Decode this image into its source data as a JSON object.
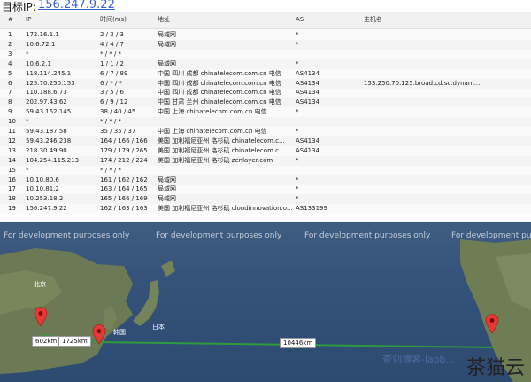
{
  "header": {
    "label": "目标IP:",
    "ip": "156.247.9.22"
  },
  "table": {
    "columns": [
      "#",
      "IP",
      "时间(ms)",
      "地址",
      "AS",
      "主机名"
    ],
    "rows": [
      [
        "1",
        "172.16.1.1",
        "2 / 3 / 3",
        "局域网",
        "*",
        ""
      ],
      [
        "2",
        "10.6.72.1",
        "4 / 4 / 7",
        "局域网",
        "*",
        ""
      ],
      [
        "3",
        "*",
        "* / * / *",
        "",
        "",
        ""
      ],
      [
        "4",
        "10.6.2.1",
        "1 / 1 / 2",
        "局域网",
        "*",
        ""
      ],
      [
        "5",
        "118.114.245.1",
        "6 / 7 / 89",
        "中国 四川 成都 chinatelecom.com.cn 电信",
        "AS4134",
        ""
      ],
      [
        "6",
        "125.70.250.153",
        "6 / * / *",
        "中国 四川 成都 chinatelecom.com.cn 电信",
        "AS4134",
        "153.250.70.125.broad.cd.sc.dynam..."
      ],
      [
        "7",
        "110.188.6.73",
        "3 / 5 / 6",
        "中国 四川 成都 chinatelecom.com.cn 电信",
        "AS4134",
        ""
      ],
      [
        "8",
        "202.97.43.62",
        "6 / 9 / 12",
        "中国 甘肃 兰州 chinatelecom.com.cn 电信",
        "AS4134",
        ""
      ],
      [
        "9",
        "59.43.152.145",
        "38 / 40 / 45",
        "中国 上海 chinatelecom.com.cn 电信",
        "*",
        ""
      ],
      [
        "10",
        "*",
        "* / * / *",
        "",
        "",
        ""
      ],
      [
        "11",
        "59.43.187.58",
        "35 / 35 / 37",
        "中国 上海 chinatelecom.com.cn 电信",
        "*",
        ""
      ],
      [
        "12",
        "59.43.246.238",
        "164 / 166 / 166",
        "美国 加利福尼亚州 洛杉矶 chinatelecom.c...",
        "AS4134",
        ""
      ],
      [
        "13",
        "218.30.49.90",
        "179 / 179 / 265",
        "美国 加利福尼亚州 洛杉矶 chinatelecom.c...",
        "AS4134",
        ""
      ],
      [
        "14",
        "104.254.115.213",
        "174 / 212 / 224",
        "美国 加利福尼亚州 洛杉矶 zenlayer.com",
        "*",
        ""
      ],
      [
        "15",
        "*",
        "* / * / *",
        "",
        "",
        ""
      ],
      [
        "16",
        "10.10.80.6",
        "161 / 162 / 162",
        "局域网",
        "*",
        ""
      ],
      [
        "17",
        "10.10.81.2",
        "163 / 164 / 165",
        "局域网",
        "*",
        ""
      ],
      [
        "18",
        "10.253.18.2",
        "165 / 166 / 169",
        "局域网",
        "*",
        ""
      ],
      [
        "19",
        "156.247.9.22",
        "162 / 163 / 163",
        "美国 加利福尼亚州 洛杉矶 cloudinnovation.o...",
        "AS133199",
        ""
      ]
    ]
  },
  "map": {
    "watermark": "For development purposes only",
    "places": {
      "beijing": "北京",
      "korea": "韩国",
      "japan": "日本"
    },
    "distances": {
      "d1": "602km",
      "d2": "1725km",
      "d3": "10446km"
    },
    "colors": {
      "pin": "#e53935",
      "route": "#2e9b3d",
      "sea": "#34527a",
      "land": "#6b7a55"
    }
  },
  "watermark_text": "查刘博客-laob...",
  "brand": "茶猫云"
}
